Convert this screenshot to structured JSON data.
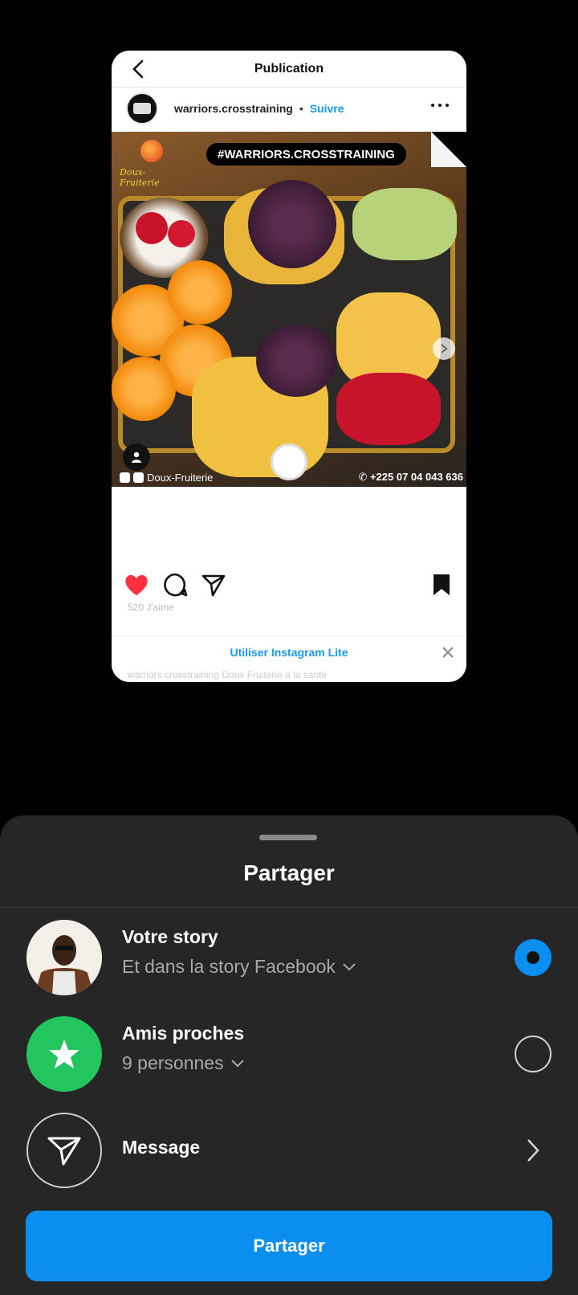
{
  "preview": {
    "header_title": "Publication",
    "author": "warriors.crosstraining",
    "dot": "•",
    "follow": "Suivre",
    "hashtag": "#WARRIORS.CROSSTRAINING",
    "brand": "Doux-Fruiterie",
    "footer_left": "Doux-Fruiterie",
    "footer_right": "+225 07 04 043 636",
    "likes_text": "520 J'aime",
    "lite_banner": "Utiliser Instagram Lite",
    "caption": "warriors.crosstraining Doux Fruiterie a la santé",
    "liked": true,
    "saved": true
  },
  "sheet": {
    "title": "Partager",
    "options": [
      {
        "title": "Votre story",
        "subtitle": "Et dans la story Facebook",
        "selected": true
      },
      {
        "title": "Amis proches",
        "subtitle": "9 personnes",
        "selected": false
      },
      {
        "title": "Message"
      }
    ],
    "button": "Partager"
  },
  "colors": {
    "accent": "#0a8ef0",
    "like": "#ff3040",
    "close_friends": "#22c55e",
    "sheet_bg": "#262626"
  }
}
